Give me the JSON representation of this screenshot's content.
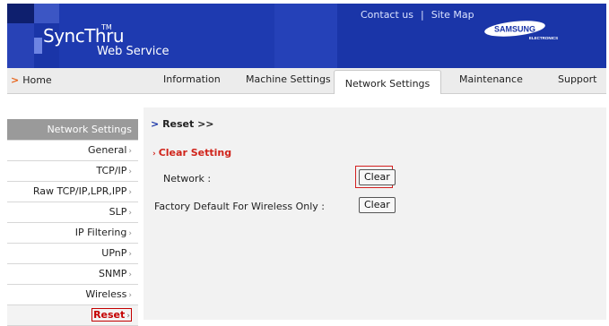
{
  "header": {
    "brand": "SyncThru",
    "brand_tm": "TM",
    "brand_sub": "Web Service",
    "contact": "Contact us",
    "separator": "|",
    "sitemap": "Site Map",
    "logo_text": "SAMSUNG",
    "logo_sub": "ELECTRONICS",
    "banner_color": "#1a35a8"
  },
  "nav": {
    "home": "Home",
    "tabs": [
      "Information",
      "Machine Settings",
      "Network Settings",
      "Maintenance",
      "Support"
    ],
    "active_tab": "Network Settings"
  },
  "sidebar": {
    "header": "Network Settings",
    "items": [
      "General",
      "TCP/IP",
      "Raw TCP/IP,LPR,IPP",
      "SLP",
      "IP Filtering",
      "UPnP",
      "SNMP",
      "Wireless",
      "Reset"
    ],
    "active_item": "Reset",
    "chevron": "›"
  },
  "content": {
    "breadcrumb": "Reset >>",
    "section_title": "Clear Setting",
    "rows": [
      {
        "label": "Network :",
        "button": "Clear"
      },
      {
        "label": "Factory Default For Wireless Only :",
        "button": "Clear"
      }
    ]
  },
  "colors": {
    "accent_red": "#d0241b",
    "nav_arrow": "#e8641b",
    "sidebar_header": "#9a9a9a"
  }
}
